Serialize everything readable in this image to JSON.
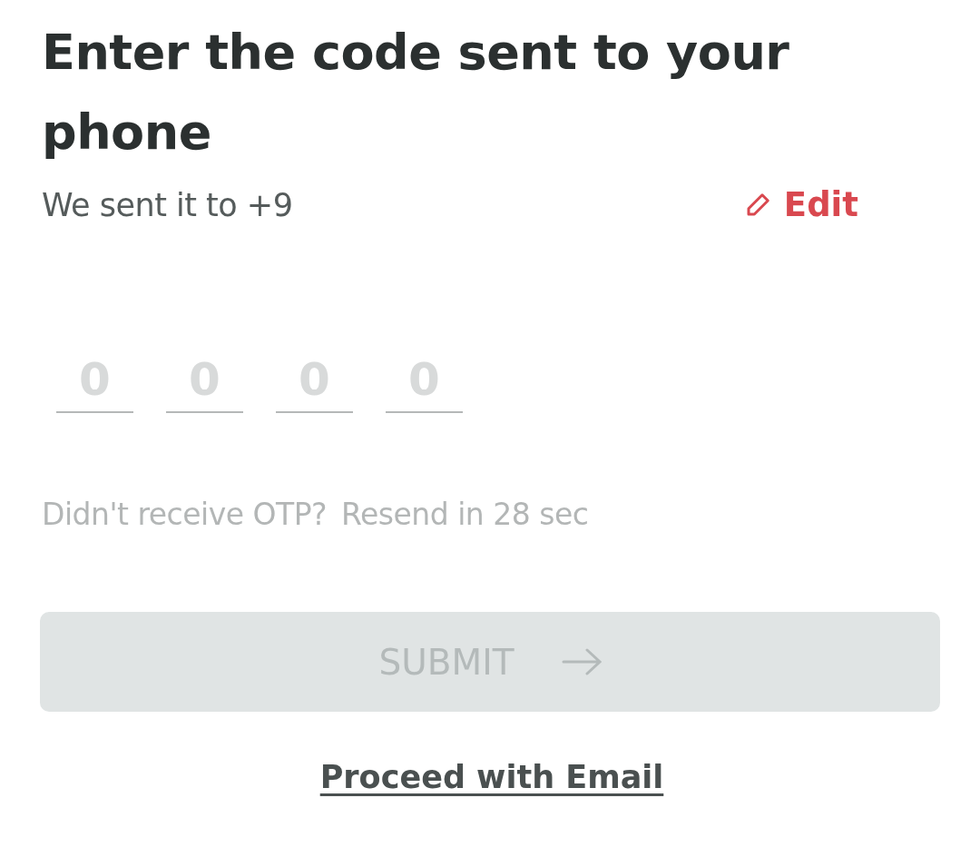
{
  "title": "Enter the code sent to your phone",
  "subtitle": "We sent it to +9",
  "edit_link": "Edit",
  "otp_fields": [
    {
      "placeholder": "0"
    },
    {
      "placeholder": "0"
    },
    {
      "placeholder": "0"
    },
    {
      "placeholder": "0"
    }
  ],
  "resend": {
    "question": "Didn't receive OTP?",
    "countdown": "Resend in 28 sec"
  },
  "submit": {
    "label": "SUBMIT",
    "disabled": true
  },
  "alt_link": "Proceed with Email"
}
